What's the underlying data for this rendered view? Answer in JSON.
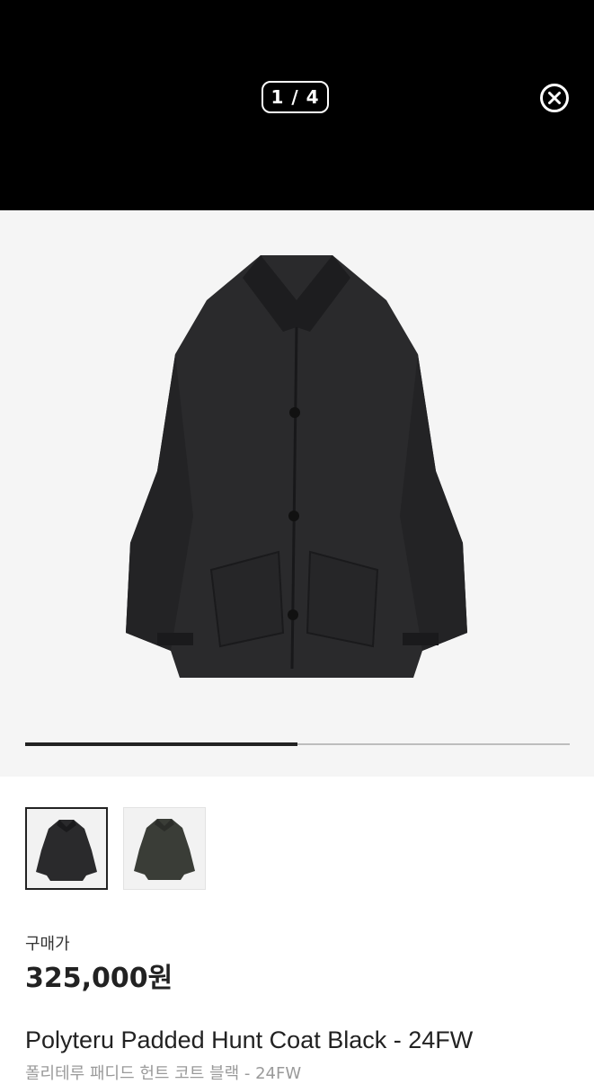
{
  "viewer": {
    "counter": "1 / 4",
    "progress": 0.5
  },
  "icons": {
    "close": "close-circle-icon"
  },
  "thumbnails": [
    {
      "selected": true
    },
    {
      "selected": false
    }
  ],
  "product": {
    "price_label": "구매가",
    "price": "325,000원",
    "title": "Polyteru Padded Hunt Coat Black - 24FW",
    "subtitle": "폴리테루 패디드 헌트 코트 블랙 - 24FW"
  },
  "colors": {
    "topbar": "#000000",
    "image_bg": "#f5f5f5",
    "accent": "#222222",
    "subtitle": "#9a9a9a"
  }
}
